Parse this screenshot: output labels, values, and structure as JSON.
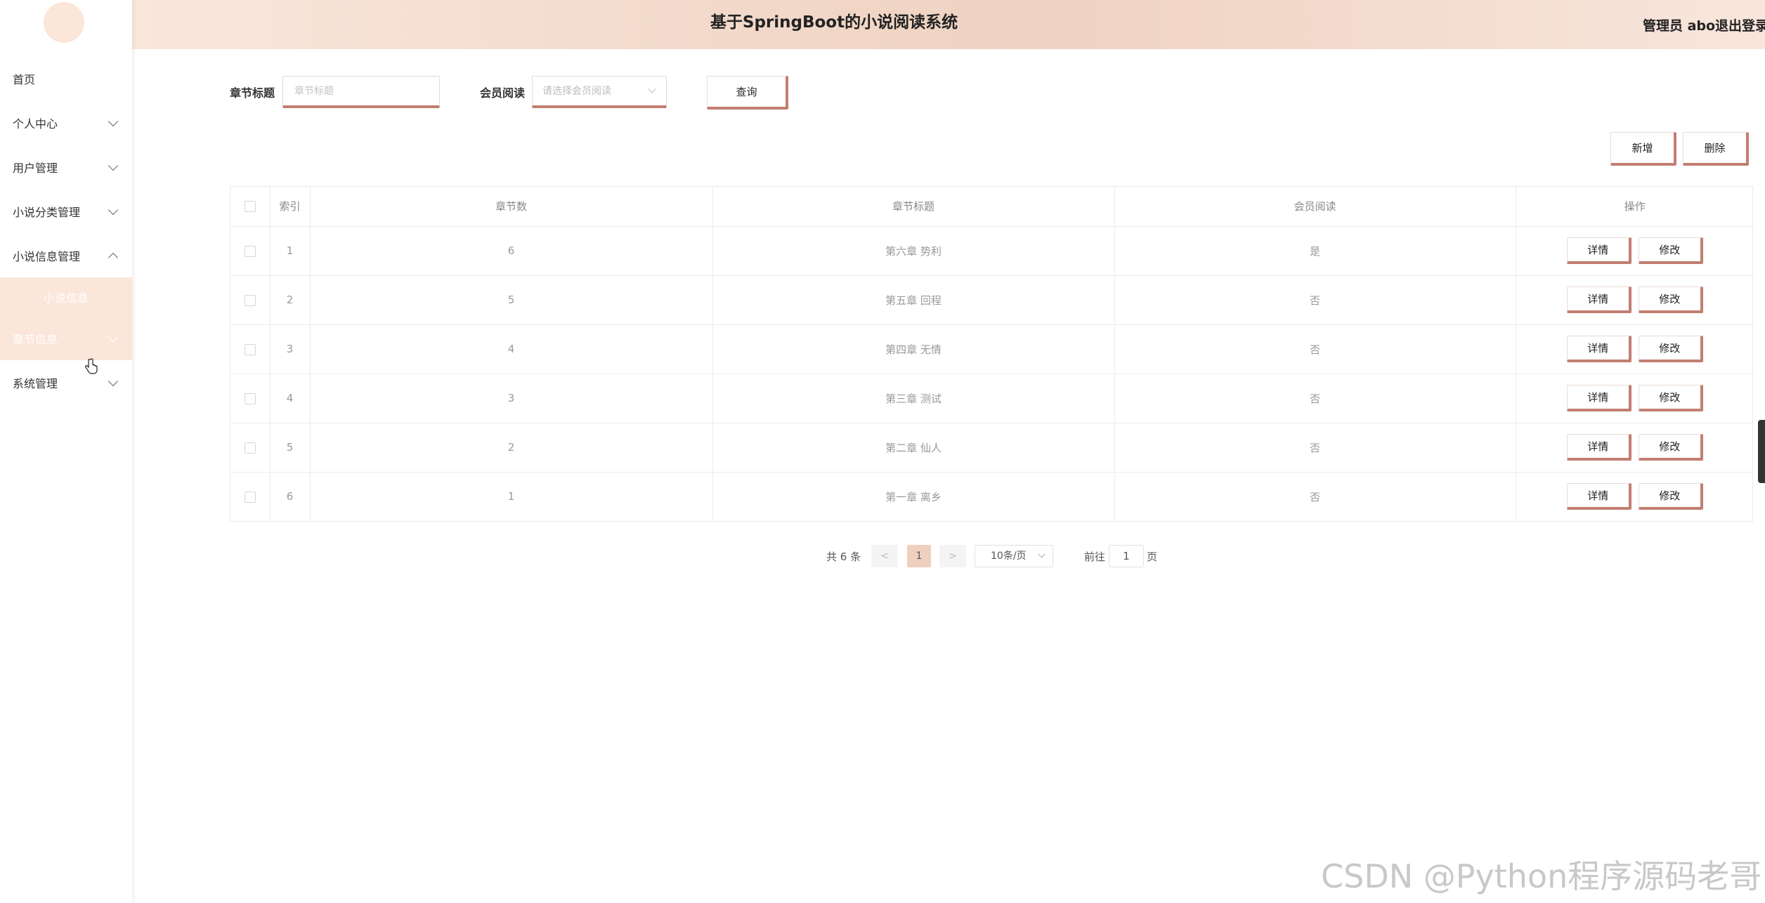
{
  "header": {
    "title": "基于SpringBoot的小说阅读系统",
    "admin": "管理员 abo",
    "logout": "退出登录"
  },
  "sidebar": {
    "items": [
      {
        "label": "首页"
      },
      {
        "label": "个人中心"
      },
      {
        "label": "用户管理"
      },
      {
        "label": "小说分类管理"
      },
      {
        "label": "小说信息管理"
      },
      {
        "label": "小说信息"
      },
      {
        "label": "章节信息"
      },
      {
        "label": "系统管理"
      }
    ]
  },
  "search": {
    "title_label": "章节标题",
    "title_placeholder": "章节标题",
    "vip_label": "会员阅读",
    "vip_placeholder": "请选择会员阅读",
    "query_label": "查询"
  },
  "actions": {
    "add": "新增",
    "delete": "删除"
  },
  "table": {
    "columns": [
      "索引",
      "章节数",
      "章节标题",
      "会员阅读",
      "操作"
    ],
    "rows": [
      {
        "index": "1",
        "chapter_no": "6",
        "title": "第六章 势利",
        "vip": "是"
      },
      {
        "index": "2",
        "chapter_no": "5",
        "title": "第五章 回程",
        "vip": "否"
      },
      {
        "index": "3",
        "chapter_no": "4",
        "title": "第四章 无情",
        "vip": "否"
      },
      {
        "index": "4",
        "chapter_no": "3",
        "title": "第三章 测试",
        "vip": "否"
      },
      {
        "index": "5",
        "chapter_no": "2",
        "title": "第二章 仙人",
        "vip": "否"
      },
      {
        "index": "6",
        "chapter_no": "1",
        "title": "第一章 离乡",
        "vip": "否"
      }
    ],
    "detail_label": "详情",
    "edit_label": "修改"
  },
  "pagination": {
    "total": "共 6 条",
    "prev": "<",
    "current": "1",
    "next": ">",
    "size": "10条/页",
    "goto_prefix": "前往",
    "goto_value": "1",
    "goto_suffix": "页"
  },
  "watermark": "CSDN @Python程序源码老哥",
  "colors": {
    "accent": "#c27e72",
    "accent_light": "#fbe6da",
    "header_gradient_mid": "#efd2c1"
  }
}
